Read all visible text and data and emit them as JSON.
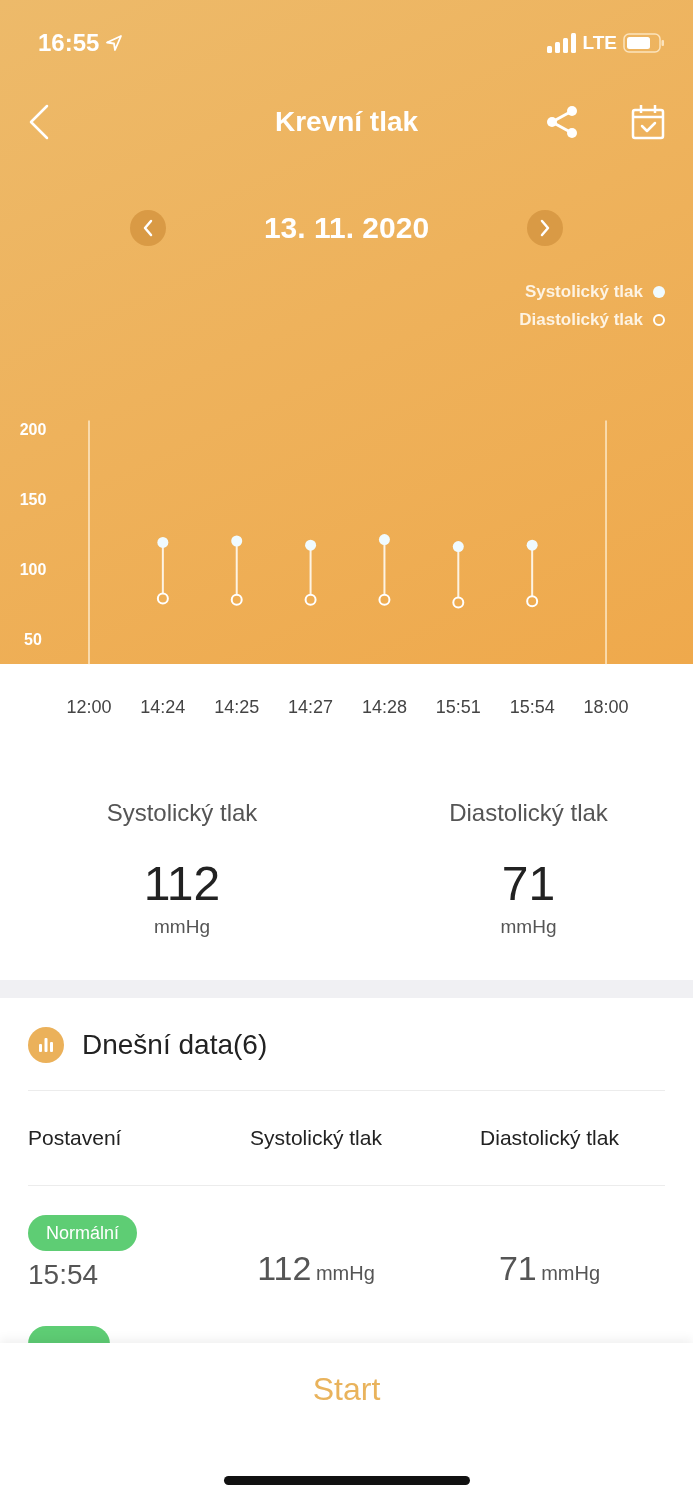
{
  "status_bar": {
    "time": "16:55",
    "network": "LTE"
  },
  "nav": {
    "title": "Krevní tlak"
  },
  "date": "13. 11. 2020",
  "chart": {
    "chart_data": {
      "type": "scatter",
      "categories": [
        "12:00",
        "14:24",
        "14:25",
        "14:27",
        "14:28",
        "15:51",
        "15:54",
        "18:00"
      ],
      "ylim": [
        32,
        206
      ],
      "yticks": [
        50,
        100,
        150,
        200
      ],
      "legend": true,
      "series": [
        {
          "name": "Systolický tlak",
          "color": "#f0fbff",
          "marker": "circle",
          "values": [
            null,
            119,
            120,
            117,
            121,
            116,
            117,
            null
          ]
        },
        {
          "name": "Diastolický tlak",
          "color": "#ffffff",
          "marker": "circle",
          "values": [
            null,
            79,
            78,
            78,
            78,
            76,
            77,
            null
          ]
        }
      ]
    },
    "point_styles": [
      {
        "kind": "filled"
      },
      {
        "kind": "hollow"
      }
    ]
  },
  "summary": [
    {
      "label": "Systolický tlak",
      "value": "112",
      "unit": "mmHg"
    },
    {
      "label": "Diastolický tlak",
      "value": "71",
      "unit": "mmHg"
    }
  ],
  "today": {
    "title": "Dnešní data(6)",
    "columns": [
      "Postavení",
      "Systolický tlak",
      "Diastolický tlak"
    ],
    "rows": [
      {
        "status": "Normální",
        "time": "15:54",
        "systolic": "112",
        "systolic_unit": "mmHg",
        "diastolic": "71",
        "diastolic_unit": "mmHg"
      },
      {
        "partial": true
      }
    ]
  },
  "start_button": "Start"
}
